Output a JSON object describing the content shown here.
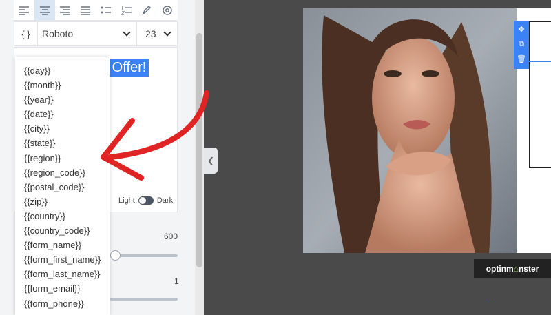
{
  "toolbar": {
    "buttons": [
      {
        "name": "align-left-icon"
      },
      {
        "name": "align-center-icon"
      },
      {
        "name": "align-right-icon"
      },
      {
        "name": "align-justify-icon"
      },
      {
        "name": "bullet-list-icon"
      },
      {
        "name": "numbered-list-icon"
      },
      {
        "name": "pen-icon"
      },
      {
        "name": "smart-tag-icon"
      }
    ]
  },
  "font": {
    "brace_label": "{ }",
    "family": "Roboto",
    "size": "23"
  },
  "editor": {
    "selected_text": "e Offer!"
  },
  "theme": {
    "light_label": "Light",
    "dark_label": "Dark"
  },
  "controls": {
    "weight_value": "600",
    "line_height_value": "1"
  },
  "smart_tags": [
    "{{day}}",
    "{{month}}",
    "{{year}}",
    "{{date}}",
    "{{city}}",
    "{{state}}",
    "{{region}}",
    "{{region_code}}",
    "{{postal_code}}",
    "{{zip}}",
    "{{country}}",
    "{{country_code}}",
    "{{form_name}}",
    "{{form_first_name}}",
    "{{form_last_name}}",
    "{{form_email}}",
    "{{form_phone}}"
  ],
  "brand": {
    "pre": "optinm",
    "mark": "⌂",
    "post": "nster"
  },
  "colors": {
    "accent": "#3b82f6",
    "arrow": "#e02424",
    "canvas": "#4a4a4a"
  }
}
